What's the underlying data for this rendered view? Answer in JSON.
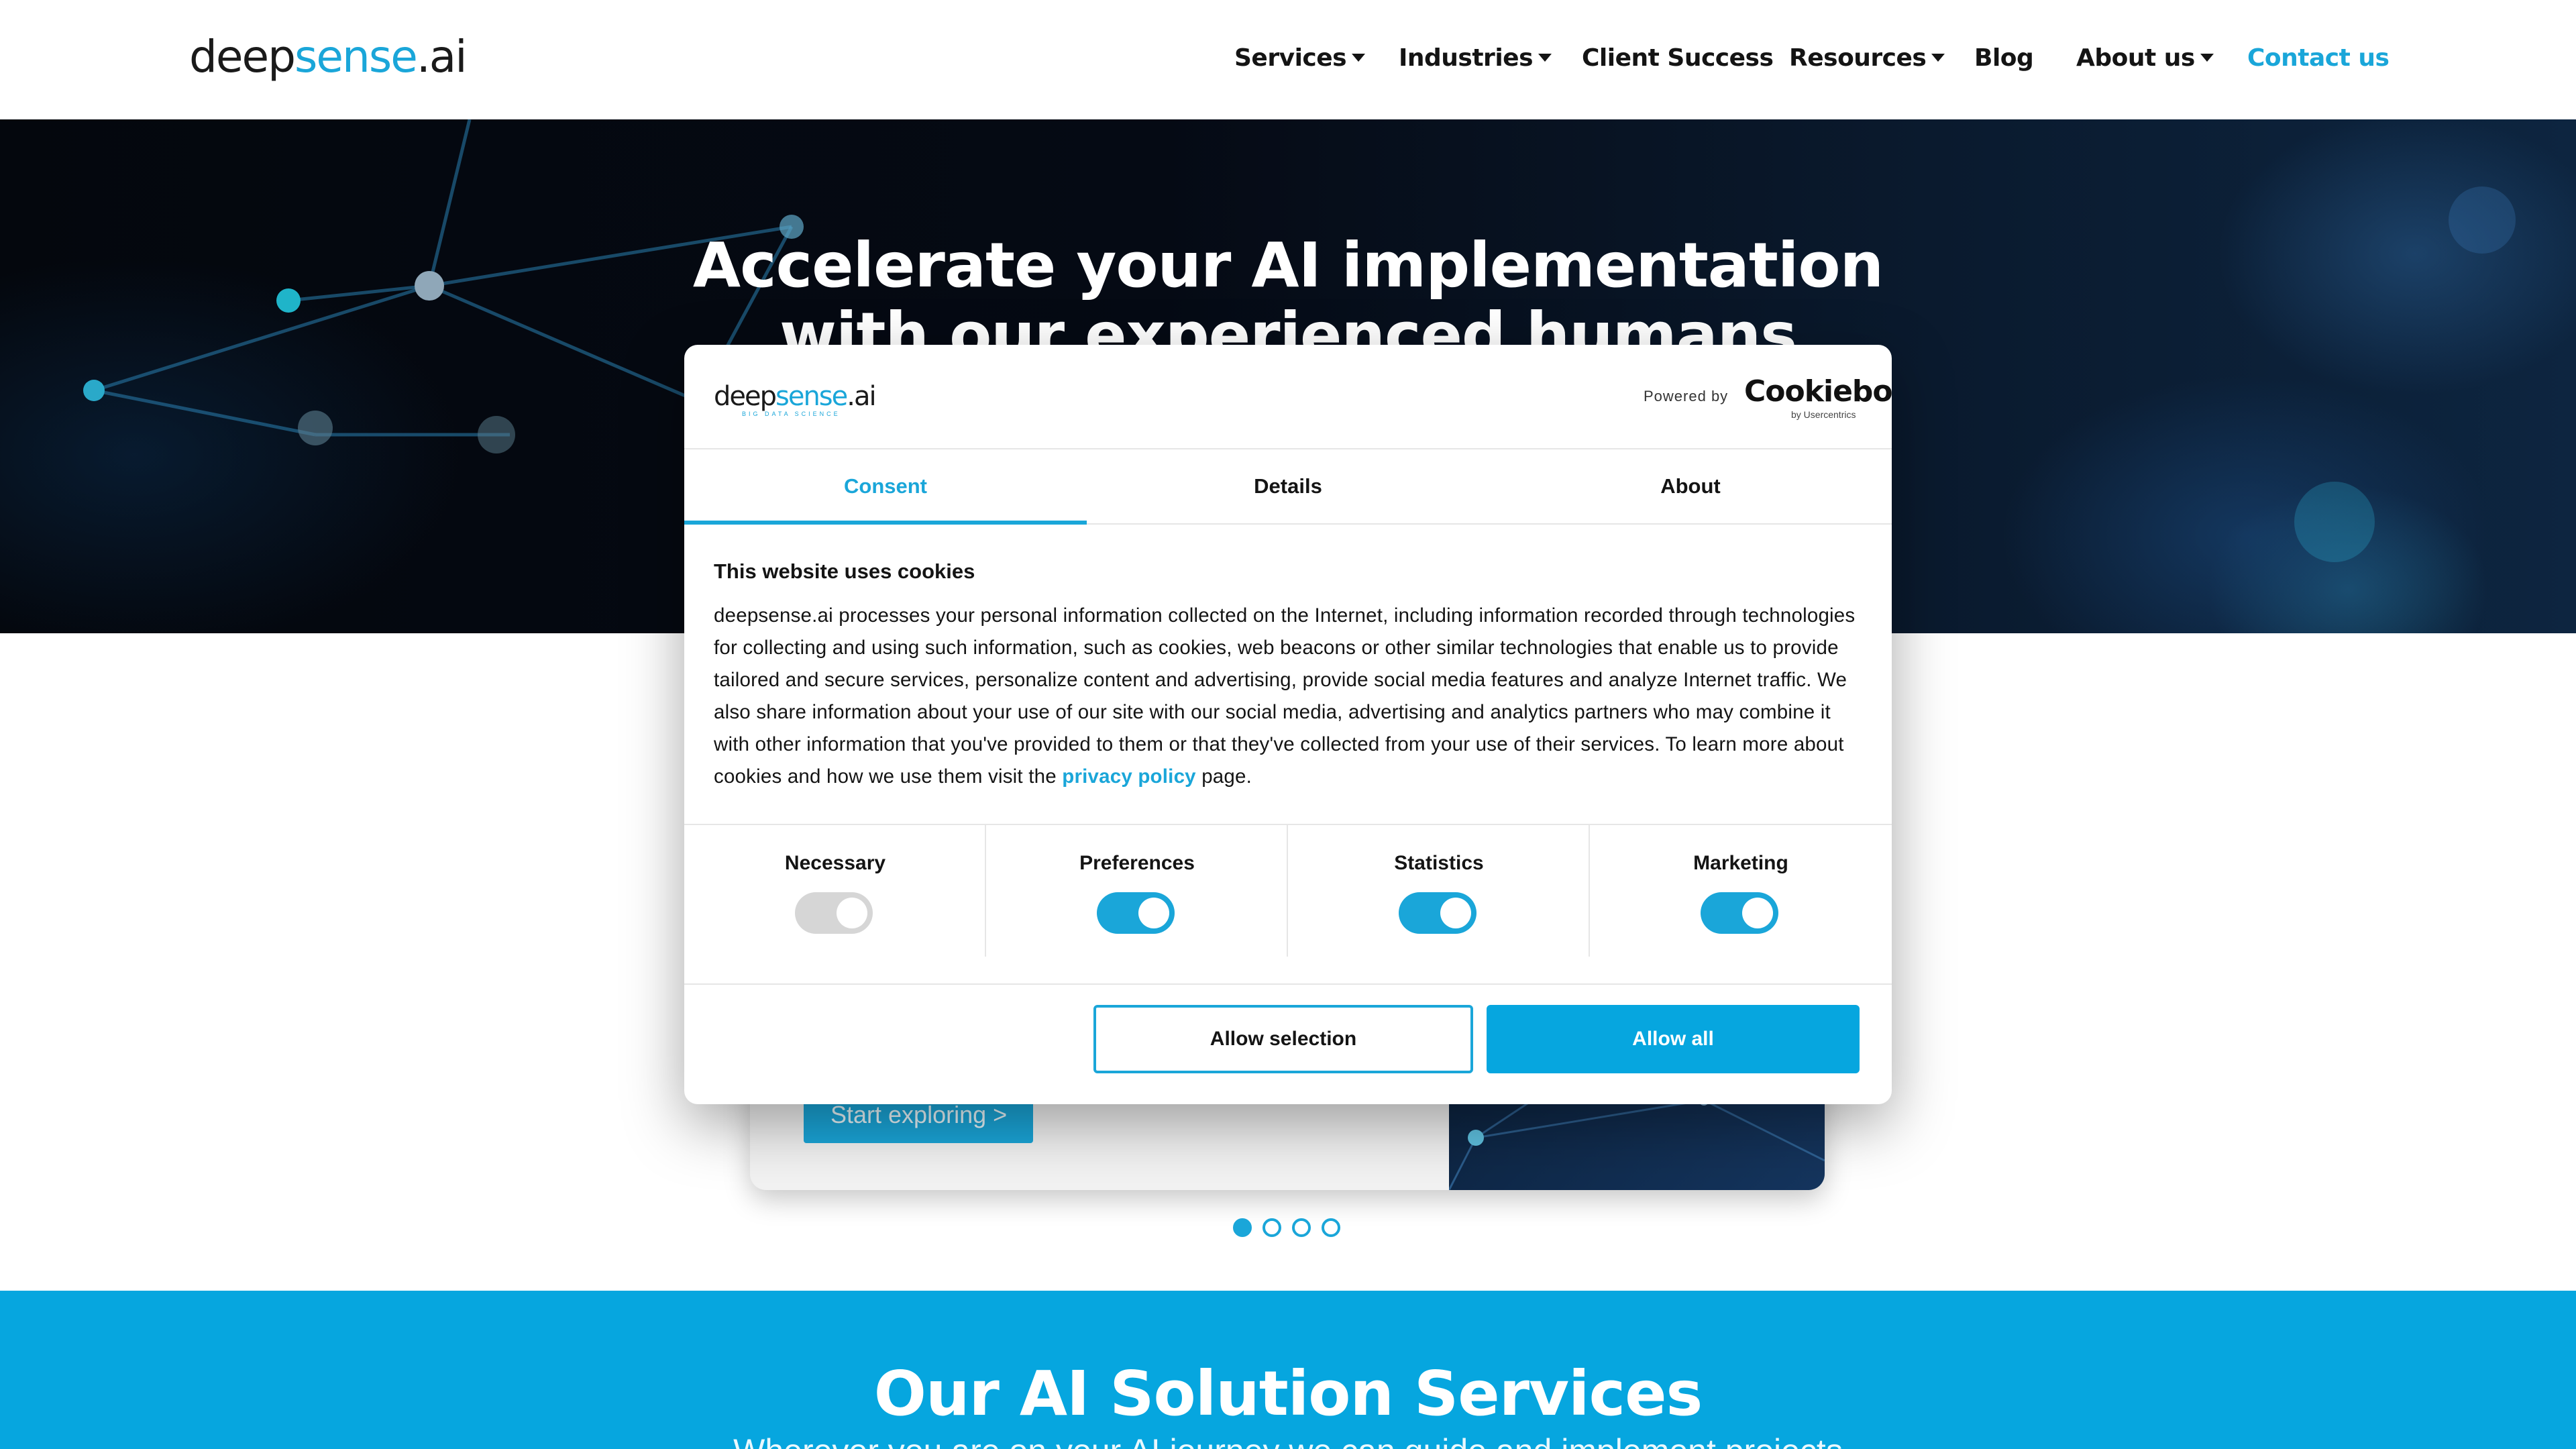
{
  "nav": {
    "logo_deep": "deep",
    "logo_sense": "sense",
    "logo_ai": ".ai",
    "items": [
      {
        "label": "Services",
        "has_dropdown": true
      },
      {
        "label": "Industries",
        "has_dropdown": true
      },
      {
        "label": "Client Success",
        "has_dropdown": false
      },
      {
        "label": "Resources",
        "has_dropdown": true
      },
      {
        "label": "Blog",
        "has_dropdown": false
      },
      {
        "label": "About us",
        "has_dropdown": true
      },
      {
        "label": "Contact us",
        "has_dropdown": false
      }
    ]
  },
  "hero": {
    "title_line1": "Accelerate your AI implementation",
    "title_line2": "with our experienced humans"
  },
  "carousel": {
    "button_label": "Start exploring >",
    "slide_count": 4,
    "active_slide": 1
  },
  "services": {
    "title": "Our AI Solution Services",
    "subtitle": "Wherever you are on your AI journey we can guide and implement projects"
  },
  "cookie_dialog": {
    "logo_deep": "deep",
    "logo_sense": "sense",
    "logo_ai": ".ai",
    "logo_sub": "BIG DATA SCIENCE",
    "powered_by": "Powered by",
    "provider": "Cookiebot",
    "provider_sub": "by Usercentrics",
    "tabs": [
      {
        "label": "Consent",
        "active": true
      },
      {
        "label": "Details",
        "active": false
      },
      {
        "label": "About",
        "active": false
      }
    ],
    "heading": "This website uses cookies",
    "body": "deepsense.ai processes your personal information collected on the Internet, including information recorded through technologies for collecting and using such information, such as cookies, web beacons or other similar technologies that enable us to provide tailored and secure services, personalize content and advertising, provide social media features and analyze Internet traffic. We also share information about your use of our site with our social media, advertising and analytics partners who may combine it with other information that you've provided to them or that they've collected from your use of their services. To learn more about cookies and how we use them visit the",
    "privacy_link": "privacy policy",
    "body_end": "page.",
    "categories": [
      {
        "label": "Necessary",
        "enabled": true,
        "locked": true
      },
      {
        "label": "Preferences",
        "enabled": true,
        "locked": false
      },
      {
        "label": "Statistics",
        "enabled": true,
        "locked": false
      },
      {
        "label": "Marketing",
        "enabled": true,
        "locked": false
      }
    ],
    "allow_selection_label": "Allow selection",
    "allow_all_label": "Allow all"
  },
  "colors": {
    "accent": "#1aa6d9",
    "services_band": "#06a6df",
    "text": "#141414"
  }
}
